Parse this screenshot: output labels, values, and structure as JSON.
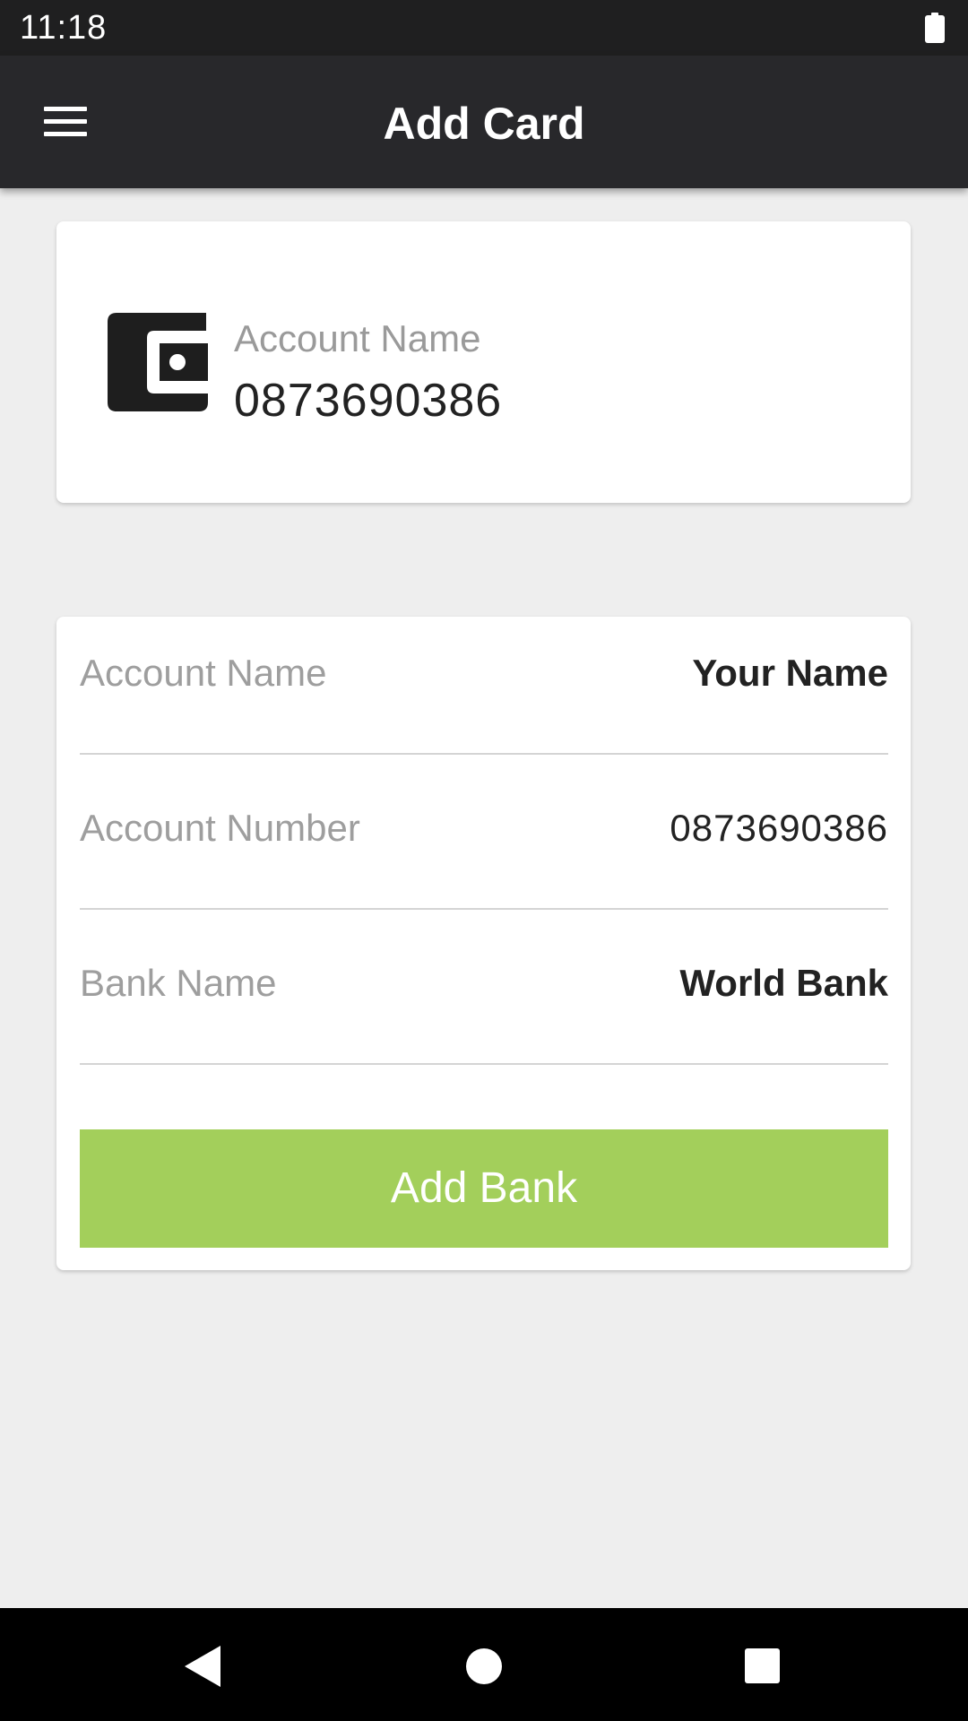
{
  "status_bar": {
    "time": "11:18",
    "battery_icon": "battery-full-icon"
  },
  "app_bar": {
    "menu_icon": "hamburger-menu-icon",
    "title": "Add Card"
  },
  "summary_card": {
    "icon": "wallet-icon",
    "label": "Account Name",
    "value": "0873690386"
  },
  "form": {
    "rows": [
      {
        "label": "Account Name",
        "value": "Your Name"
      },
      {
        "label": "Account Number",
        "value": "0873690386"
      },
      {
        "label": "Bank Name",
        "value": "World Bank"
      }
    ],
    "submit_label": "Add Bank"
  },
  "nav_bar": {
    "back_icon": "back-triangle-icon",
    "home_icon": "home-circle-icon",
    "recents_icon": "recents-square-icon"
  },
  "colors": {
    "status_bar": "#1f1f20",
    "app_bar": "#28282b",
    "background": "#eeeeee",
    "accent_button": "#a3cf5b",
    "label_text": "#9e9e9e",
    "value_text": "#222222"
  }
}
